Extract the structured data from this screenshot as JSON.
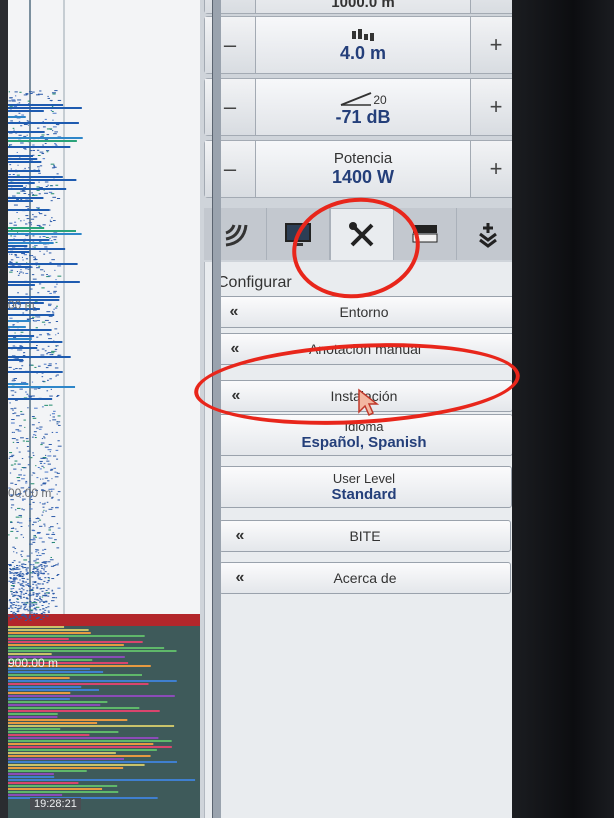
{
  "range_partial": "1000.0 m",
  "controls": [
    {
      "title": "",
      "value": "4.0 m",
      "icon": "signal-bars-icon"
    },
    {
      "title": "20",
      "value": "-71 dB",
      "icon": "gain-slope-icon"
    },
    {
      "title": "Potencia",
      "value": "1400 W",
      "icon": ""
    }
  ],
  "minus": "–",
  "plus": "+",
  "tabs": [
    {
      "icon": "sonar-icon"
    },
    {
      "icon": "display-icon"
    },
    {
      "icon": "tools-icon",
      "active": true
    },
    {
      "icon": "color-bar-icon"
    },
    {
      "icon": "install-download-icon"
    }
  ],
  "config": {
    "title": "Configurar",
    "items": [
      {
        "label": "Entorno"
      },
      {
        "label": "Anotación manual"
      },
      {
        "label": "Instalación"
      }
    ],
    "idioma": {
      "title": "Idioma",
      "value": "Español, Spanish"
    },
    "user_level": {
      "title": "User Level",
      "value": "Standard"
    },
    "items2": [
      {
        "label": "BITE"
      },
      {
        "label": "Acerca de"
      }
    ],
    "chevron": "«"
  },
  "echogram": {
    "depth_labels": [
      "00 m",
      "00.00 m",
      "900.00 m"
    ],
    "time": "19:28:21"
  },
  "colors": {
    "annotation": "#e8261b",
    "value_text": "#243f7a",
    "bottom_line": "#b3262b"
  }
}
